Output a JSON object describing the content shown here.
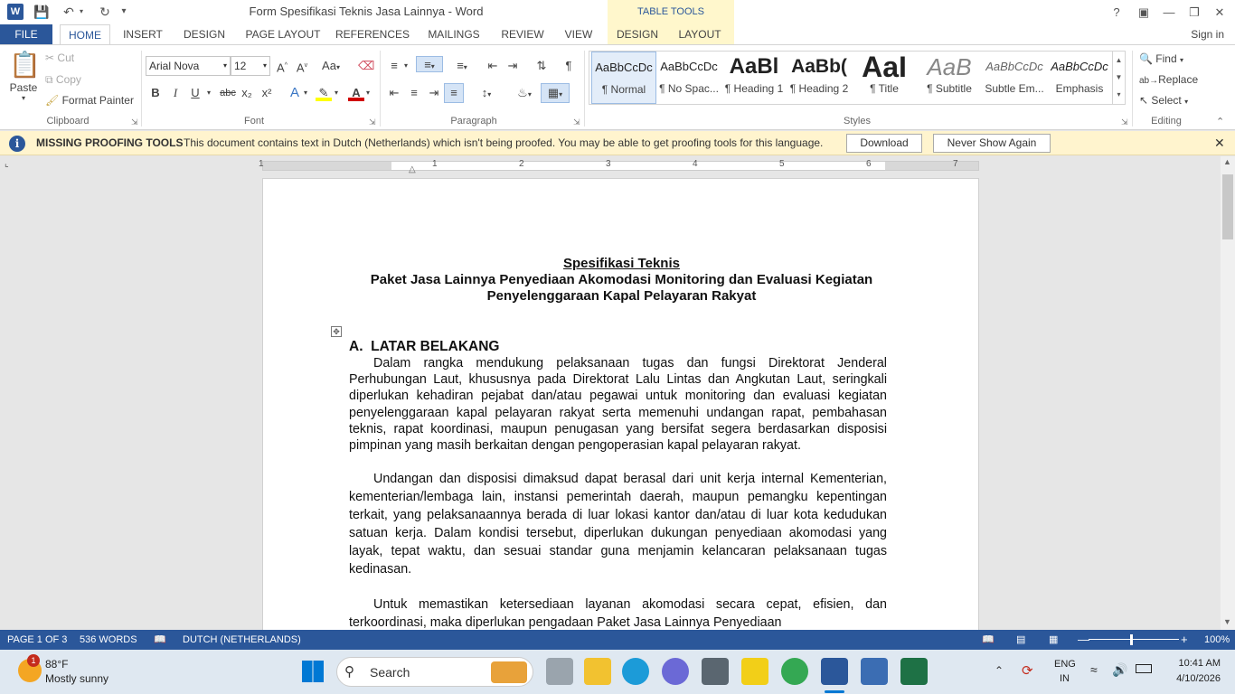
{
  "titlebar": {
    "title": "Form Spesifikasi Teknis Jasa Lainnya - Word",
    "table_tools": "TABLE TOOLS",
    "help": "?"
  },
  "tabs": {
    "file": "FILE",
    "items": [
      "HOME",
      "INSERT",
      "DESIGN",
      "PAGE LAYOUT",
      "REFERENCES",
      "MAILINGS",
      "REVIEW",
      "VIEW"
    ],
    "tt_design": "DESIGN",
    "tt_layout": "LAYOUT",
    "signin": "Sign in"
  },
  "clipboard": {
    "paste": "Paste",
    "cut": "Cut",
    "copy": "Copy",
    "format_painter": "Format Painter",
    "label": "Clipboard"
  },
  "font": {
    "name": "Arial Nova",
    "size": "12",
    "label": "Font",
    "bold": "B",
    "italic": "I",
    "underline": "U",
    "strike": "abc",
    "sub": "x₂",
    "sup": "x²",
    "aa": "Aa"
  },
  "paragraph": {
    "label": "Paragraph"
  },
  "styles": {
    "label": "Styles",
    "items": [
      {
        "sample": "AaBbCcDc",
        "name": "¶ Normal"
      },
      {
        "sample": "AaBbCcDc",
        "name": "¶ No Spac..."
      },
      {
        "sample": "AaBl",
        "name": "¶ Heading 1"
      },
      {
        "sample": "AaBb(",
        "name": "¶ Heading 2"
      },
      {
        "sample": "AaI",
        "name": "¶ Title"
      },
      {
        "sample": "AaB",
        "name": "¶ Subtitle"
      },
      {
        "sample": "AaBbCcDc",
        "name": "Subtle Em..."
      },
      {
        "sample": "AaBbCcDc",
        "name": "Emphasis"
      }
    ]
  },
  "editing": {
    "find": "Find",
    "replace": "Replace",
    "select": "Select",
    "label": "Editing"
  },
  "infobar": {
    "title": "MISSING PROOFING TOOLS",
    "message": "This document contains text in Dutch (Netherlands) which isn't being proofed. You may be able to get proofing tools for this language.",
    "download": "Download",
    "never": "Never Show Again"
  },
  "ruler": {
    "nums": [
      "1",
      "1",
      "2",
      "3",
      "4",
      "5",
      "6",
      "7"
    ]
  },
  "document": {
    "title1": "Spesifikasi Teknis",
    "title2": "Paket Jasa Lainnya Penyediaan Akomodasi Monitoring dan Evaluasi Kegiatan",
    "title3": "Penyelenggaraan Kapal Pelayaran Rakyat",
    "heading": "A.  LATAR BELAKANG",
    "p1": "Dalam rangka mendukung pelaksanaan tugas dan fungsi Direktorat Jenderal Perhubungan Laut, khususnya pada Direktorat Lalu Lintas dan Angkutan Laut, seringkali diperlukan kehadiran pejabat dan/atau pegawai untuk monitoring dan evaluasi kegiatan penyelenggaraan kapal pelayaran rakyat serta memenuhi undangan rapat, pembahasan teknis, rapat koordinasi, maupun penugasan yang bersifat segera berdasarkan disposisi pimpinan yang masih berkaitan dengan pengoperasian kapal pelayaran rakyat.",
    "p2": "Undangan dan disposisi dimaksud dapat berasal dari unit kerja internal Kementerian, kementerian/lembaga lain, instansi pemerintah daerah, maupun pemangku kepentingan terkait, yang pelaksanaannya berada di luar lokasi kantor dan/atau di luar kota kedudukan satuan kerja. Dalam kondisi tersebut, diperlukan dukungan penyediaan akomodasi yang layak, tepat waktu, dan sesuai standar guna menjamin kelancaran pelaksanaan tugas kedinasan.",
    "p3": "Untuk memastikan ketersediaan layanan akomodasi secara cepat, efisien, dan terkoordinasi, maka diperlukan pengadaan Paket Jasa Lainnya Penyediaan"
  },
  "status": {
    "page": "PAGE 1 OF 3",
    "words": "536 WORDS",
    "lang": "DUTCH (NETHERLANDS)",
    "zoom": "100%"
  },
  "taskbar": {
    "weather_temp": "88°F",
    "weather_desc": "Mostly sunny",
    "badge": "1",
    "search": "Search",
    "lang1": "ENG",
    "lang2": "IN",
    "time": "10:41 AM",
    "date": "4/10/2026"
  },
  "colors": {
    "accent": "#2b579a",
    "infobar": "#fff4ce",
    "table_tools": "#fff7cc"
  }
}
